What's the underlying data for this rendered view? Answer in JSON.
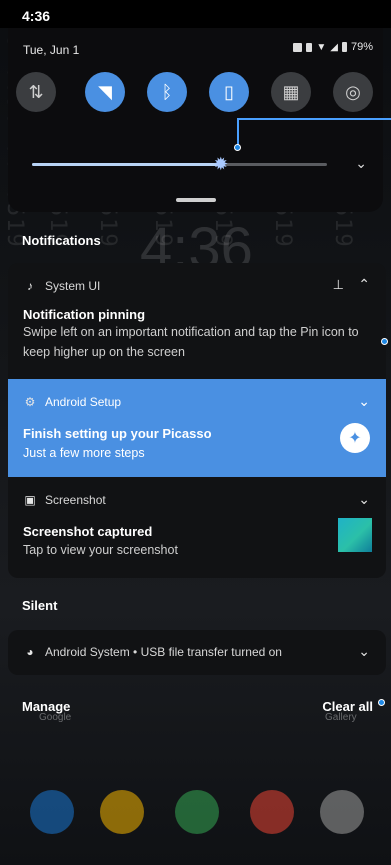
{
  "status_bar": {
    "time": "4:36"
  },
  "quick_settings": {
    "date": "Tue, Jun 1",
    "battery": "79%",
    "tiles": [
      {
        "name": "mobile-data",
        "icon": "data-arrows-icon",
        "glyph": "⇅",
        "on": false
      },
      {
        "name": "wifi",
        "icon": "wifi-icon",
        "glyph": "◥",
        "on": true
      },
      {
        "name": "bluetooth",
        "icon": "bluetooth-icon",
        "glyph": "ᛒ",
        "on": true
      },
      {
        "name": "vibrate",
        "icon": "vibrate-icon",
        "glyph": "▯",
        "on": true
      },
      {
        "name": "qr-scanner",
        "icon": "qr-code-icon",
        "glyph": "▦",
        "on": false
      },
      {
        "name": "hotspot",
        "icon": "hotspot-icon",
        "glyph": "◎",
        "on": false
      }
    ],
    "brightness_level": 0.64
  },
  "lockscreen_clock": "4:36",
  "watermark_text": "357805640010519",
  "notifications": {
    "header": "Notifications",
    "items": [
      {
        "app": "System UI",
        "title": "Notification pinning",
        "body": "Swipe left on an important notification and tap the Pin icon to keep higher up on the screen"
      },
      {
        "app": "Android Setup",
        "title": "Finish setting up your Picasso",
        "body": "Just a few more steps"
      },
      {
        "app": "Screenshot",
        "title": "Screenshot captured",
        "body": "Tap to view your screenshot"
      }
    ]
  },
  "silent": {
    "header": "Silent",
    "item": "Android System • USB file transfer turned on"
  },
  "actions": {
    "manage": "Manage",
    "clear_all": "Clear all"
  },
  "background_labels": {
    "left": "Google",
    "right": "Gallery"
  },
  "colors": {
    "accent": "#4a90e2",
    "card": "#111214",
    "callout": "#1e88e5"
  }
}
